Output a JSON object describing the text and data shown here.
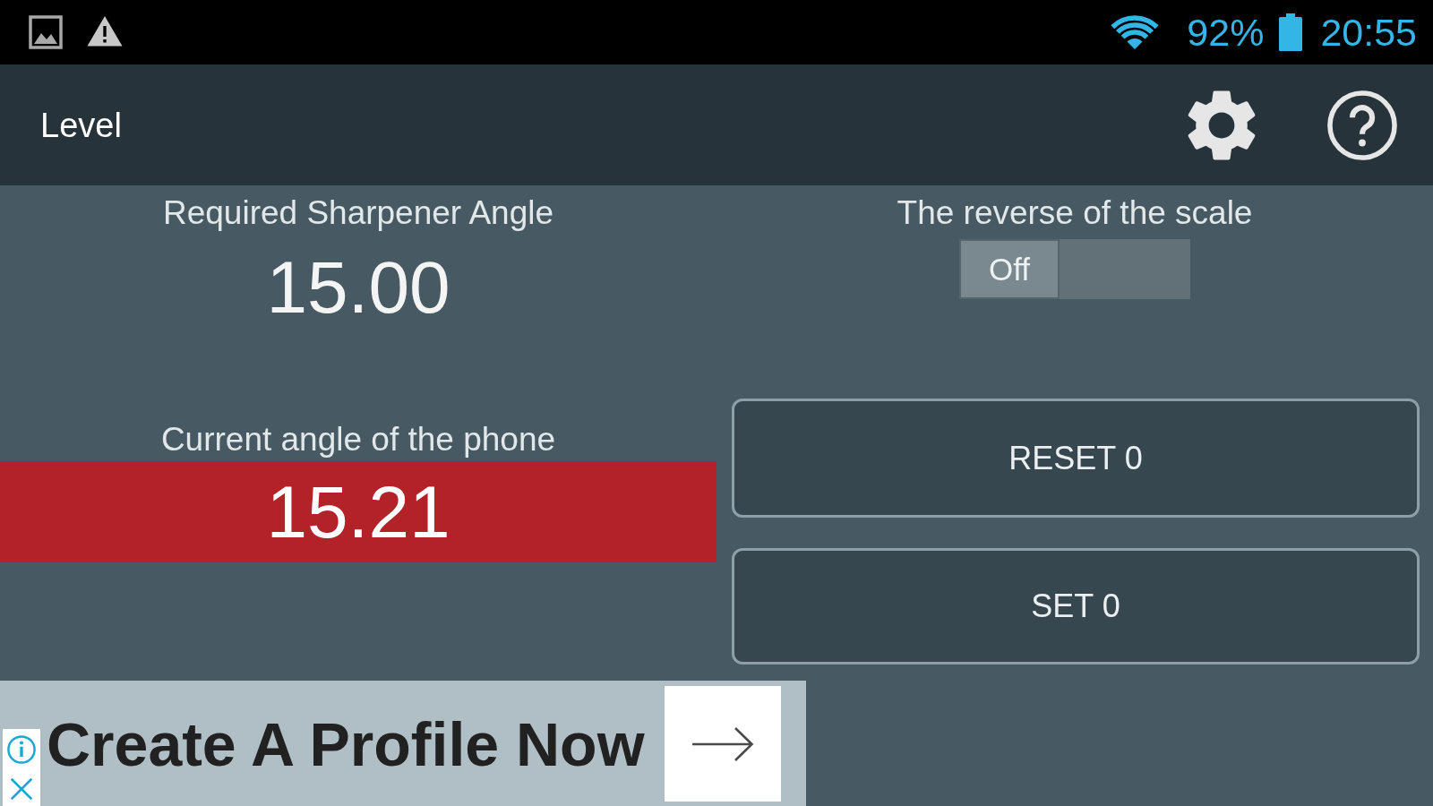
{
  "status_bar": {
    "battery": "92%",
    "time": "20:55"
  },
  "app_bar": {
    "title": "Level"
  },
  "required_angle": {
    "label": "Required Sharpener Angle",
    "value": "15.00"
  },
  "reverse_scale": {
    "label": "The reverse of the scale",
    "switch": {
      "text": "Off",
      "on": false
    }
  },
  "current_angle": {
    "label": "Current angle of the phone",
    "value": "15.21",
    "on_target": false
  },
  "buttons": [
    {
      "label": "RESET 0"
    },
    {
      "label": "SET 0"
    }
  ],
  "ad": {
    "headline": "Create A Profile Now"
  }
}
